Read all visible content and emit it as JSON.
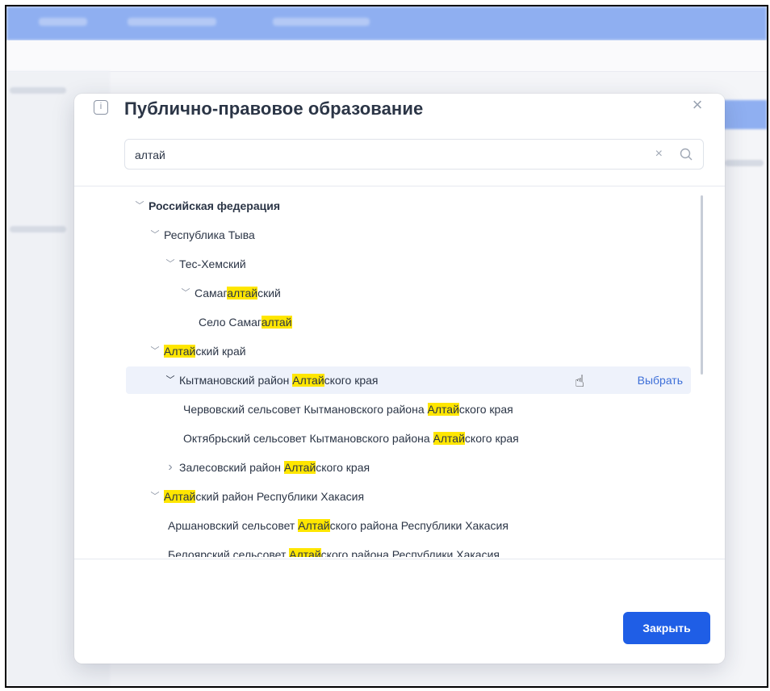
{
  "modal": {
    "title": "Публично-правовое образование",
    "search_value": "алтай",
    "pick_label": "Выбрать",
    "close_button_label": "Закрыть"
  },
  "tree": [
    {
      "level": 0,
      "expanded": true,
      "chevron": "down",
      "parts": [
        "Российская федерация"
      ],
      "bold": true
    },
    {
      "level": 1,
      "expanded": true,
      "chevron": "down",
      "parts": [
        "Республика Тыва"
      ]
    },
    {
      "level": 2,
      "expanded": true,
      "chevron": "down",
      "parts": [
        "Тес-Хемский"
      ]
    },
    {
      "level": 3,
      "expanded": true,
      "chevron": "down",
      "parts": [
        "Самаг",
        "алтай",
        "ский"
      ]
    },
    {
      "level": 4,
      "chevron": "none",
      "parts": [
        "Село Самаг",
        "алтай",
        ""
      ]
    },
    {
      "level": 1,
      "expanded": true,
      "chevron": "down",
      "parts": [
        "",
        "Алтай",
        "ский край"
      ]
    },
    {
      "level": 2,
      "expanded": true,
      "chevron": "down-dark",
      "selected": true,
      "parts": [
        "Кытмановский район ",
        "Алтай",
        "ского края"
      ]
    },
    {
      "level": 3,
      "chevron": "none",
      "parts": [
        "Червовский сельсовет Кытмановского района ",
        "Алтай",
        "ского края"
      ]
    },
    {
      "level": 3,
      "chevron": "none",
      "parts": [
        "Октябрьский сельсовет Кытмановского района ",
        "Алтай",
        "ского края"
      ]
    },
    {
      "level": 2,
      "expanded": false,
      "chevron": "right",
      "parts": [
        "Залесовский район ",
        "Алтай",
        "ского края"
      ]
    },
    {
      "level": 1,
      "expanded": true,
      "chevron": "down",
      "parts": [
        "",
        "Алтай",
        "ский район Республики Хакасия"
      ]
    },
    {
      "level": 2,
      "chevron": "none",
      "parts": [
        "Аршановский сельсовет ",
        "Алтай",
        "ского района Республики Хакасия"
      ]
    },
    {
      "level": 2,
      "chevron": "none",
      "parts": [
        "Белоярский сельсовет ",
        "Алтай",
        "ского района Республики Хакасия"
      ]
    }
  ],
  "colors": {
    "accent": "#1f5ee6",
    "highlight": "#ffe600",
    "link": "#3d6fd8",
    "selected_row": "#eef2fb"
  },
  "icons": {
    "info": "info-icon",
    "close": "close-icon",
    "clear": "clear-icon",
    "search": "search-icon",
    "cursor": "hand-pointer-icon"
  }
}
